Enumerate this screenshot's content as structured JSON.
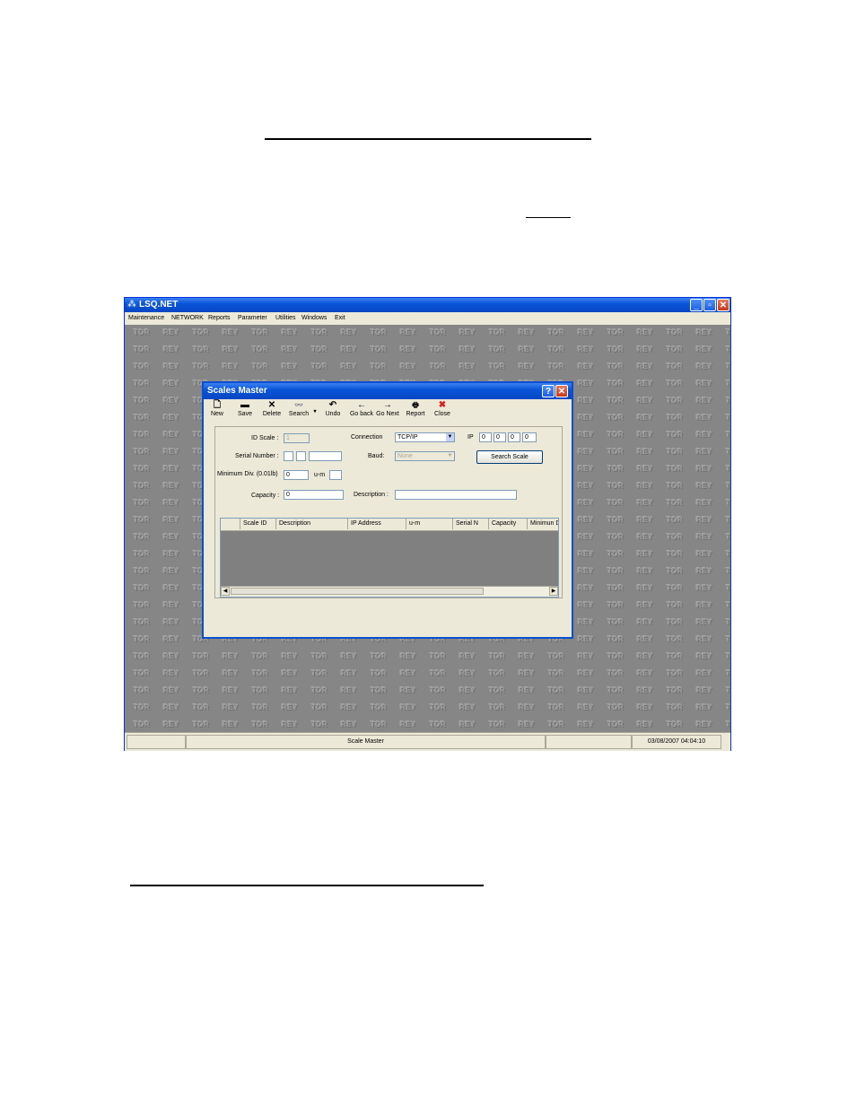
{
  "app": {
    "title": "LSQ.NET",
    "window_buttons": {
      "minimize": "_",
      "restore": "▫",
      "close": "✕"
    },
    "menu": [
      "Maintenance",
      "NETWORK",
      "Reports",
      "Parameter",
      "Utilities",
      "Windows",
      "Exit"
    ],
    "wallpaper_words": [
      "TOR",
      "REY"
    ],
    "status": {
      "center": "Scale Master",
      "datetime": "03/08/2007 04:04:10"
    }
  },
  "dialog": {
    "title": "Scales Master",
    "title_buttons": {
      "help": "?",
      "close": "✕"
    },
    "toolbar": [
      {
        "label": "New",
        "icon": "🗋"
      },
      {
        "label": "Save",
        "icon": "▬"
      },
      {
        "label": "Delete",
        "icon": "✕"
      },
      {
        "label": "Search",
        "icon": "👓"
      },
      {
        "label": "Undo",
        "icon": "↶"
      },
      {
        "label": "Go back",
        "icon": "←"
      },
      {
        "label": "Go Next",
        "icon": "→"
      },
      {
        "label": "Report",
        "icon": "🖶"
      },
      {
        "label": "Close",
        "icon": "✖"
      }
    ],
    "form": {
      "id_scale_label": "ID Scale :",
      "id_scale_value": "1",
      "connection_label": "Connection",
      "connection_value": "TCP/IP",
      "ip_label": "IP",
      "ip_octets": [
        "0",
        "0",
        "0",
        "0"
      ],
      "serial_label": "Serial Number :",
      "baud_label": "Baud:",
      "baud_value": "None",
      "search_scale_button": "Search Scale",
      "min_div_label": "Minimum Div. (0.01lb)",
      "min_div_value": "0",
      "um_label": "u-m",
      "capacity_label": "Capacity :",
      "capacity_value": "0",
      "description_label": "Description :",
      "description_value": ""
    },
    "grid": {
      "columns": [
        "Scale ID",
        "Description",
        "IP Address",
        "u-m",
        "Serial N",
        "Capacity",
        "Minimun D"
      ]
    }
  }
}
